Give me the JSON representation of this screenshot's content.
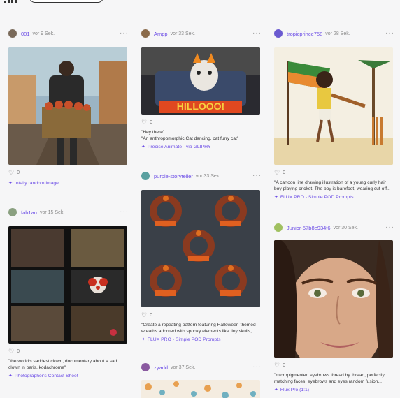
{
  "cards": {
    "c1a": {
      "user": "001",
      "time": "vor 9 Sek.",
      "likes": "0",
      "prompt": "",
      "tool": "totally random image",
      "avatar_color": "#7a6a5a"
    },
    "c1b": {
      "user": "fab1an",
      "time": "vor 15 Sek.",
      "likes": "0",
      "prompt": "\"the world's saddest clown, documentary about a sad clown in paris, kodachrome\"",
      "tool": "Photographer's Contact Sheet",
      "avatar_color": "#8aa080"
    },
    "c2a": {
      "user": "Ampp",
      "time": "vor 33 Sek.",
      "likes": "0",
      "prompt": "\"Hey there\"\n\"An anthropomorphic Cat dancing, cat furry cat\"",
      "tool": "Precise Animate - via GLIPHY",
      "avatar_color": "#8a6a4a"
    },
    "c2b": {
      "user": "purple-storyteller",
      "time": "vor 33 Sek.",
      "likes": "0",
      "prompt": "\"Create a repeating pattern featuring Halloween-themed wreaths adorned with spooky elements like tiny skulls,...",
      "tool": "FLUX PRO - Simple POD Prompts",
      "avatar_color": "#5aa0a0"
    },
    "c2c": {
      "user": "zyadd",
      "time": "vor 37 Sek.",
      "avatar_color": "#8a5aa0"
    },
    "c3a": {
      "user": "tropicprince758",
      "time": "vor 28 Sek.",
      "likes": "0",
      "prompt": "\"A cartoon line drawing illustration of a young curly hair boy playing cricket. The boy is barefoot, wearing cut-off...",
      "tool": "FLUX PRO - Simple POD Prompts",
      "avatar_color": "#6a5ad0"
    },
    "c3b": {
      "user": "Junior-57b8e934f6",
      "time": "vor 30 Sek.",
      "likes": "0",
      "prompt": "\"micropigmented eyebrows thread by thread, perfectly matching faces, eyebrows and eyes random fusion...",
      "tool": "Flux Pro (1:1)",
      "avatar_color": "#a0c060"
    }
  },
  "images": {
    "c2a_text": "HILLOOO!"
  },
  "colors": {
    "accent": "#6b4ce6",
    "background": "#f6f6f7"
  },
  "icons": {
    "like": "heart-outline-icon",
    "tool": "sparkle-icon",
    "more": "more-dots-icon"
  }
}
